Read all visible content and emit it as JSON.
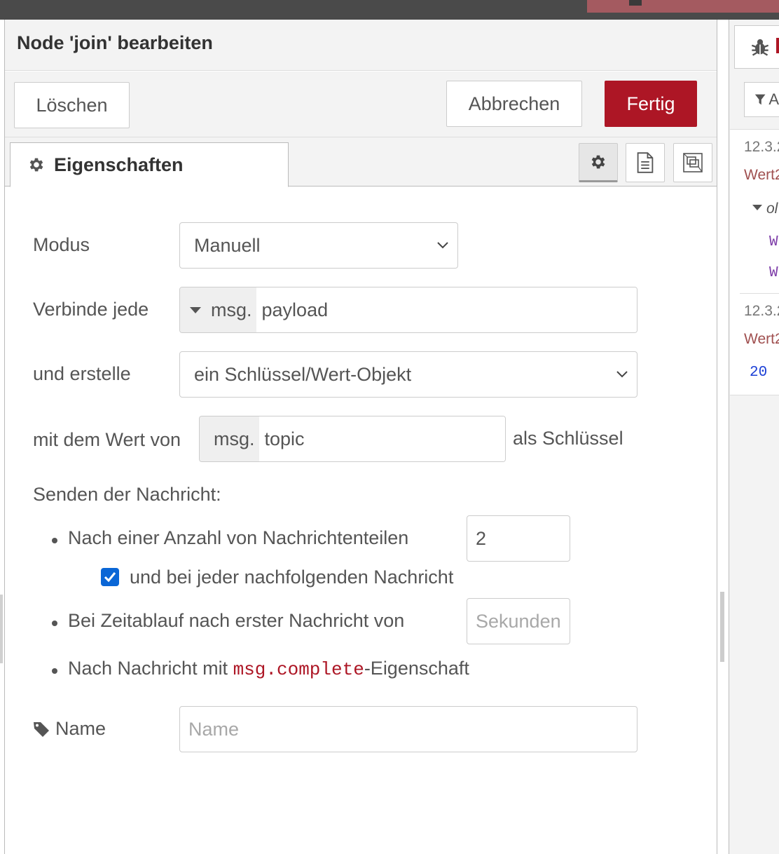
{
  "tray": {
    "title": "Node 'join' bearbeiten",
    "buttons": {
      "delete": "Löschen",
      "cancel": "Abbrechen",
      "done": "Fertig"
    },
    "tab_label": "Eigenschaften"
  },
  "form": {
    "mode_label": "Modus",
    "mode_value": "Manuell",
    "combine_label": "Verbinde jede",
    "combine_prefix": "msg.",
    "combine_value": "payload",
    "create_label": "und erstelle",
    "create_value": "ein Schlüssel/Wert-Objekt",
    "value_of_label": "mit dem Wert von",
    "key_prefix": "msg.",
    "key_value": "topic",
    "as_key_label": "als Schlüssel",
    "send_label": "Senden der Nachricht:",
    "after_parts_label": "Nach einer Anzahl von Nachrichtenteilen",
    "count_value": "2",
    "subsequent_label": "und bei jeder nachfolgenden Nachricht",
    "subsequent_checked": true,
    "timeout_label": "Bei Zeitablauf nach erster Nachricht von",
    "seconds_placeholder": "Sekunden",
    "complete_before": "Nach Nachricht mit ",
    "complete_code": "msg.complete",
    "complete_after": "-Eigenschaft",
    "name_label": "Name",
    "name_placeholder": "Name"
  },
  "sidebar": {
    "filter_text": "A",
    "messages": [
      {
        "date": "12.3.2",
        "topic": "Wert2",
        "expander": "ol",
        "props": [
          "W",
          "W"
        ]
      },
      {
        "date": "12.3.2",
        "topic": "Wert2",
        "value": "20"
      }
    ]
  },
  "colors": {
    "primary": "#ad1625",
    "checkbox": "#0a66d6",
    "code": "#ad1625"
  },
  "icons": [
    "gear-icon",
    "description-icon",
    "appearance-icon",
    "chevron-down-icon",
    "caret-down-icon",
    "checkmark-icon",
    "tag-icon",
    "bug-icon",
    "filter-icon"
  ]
}
